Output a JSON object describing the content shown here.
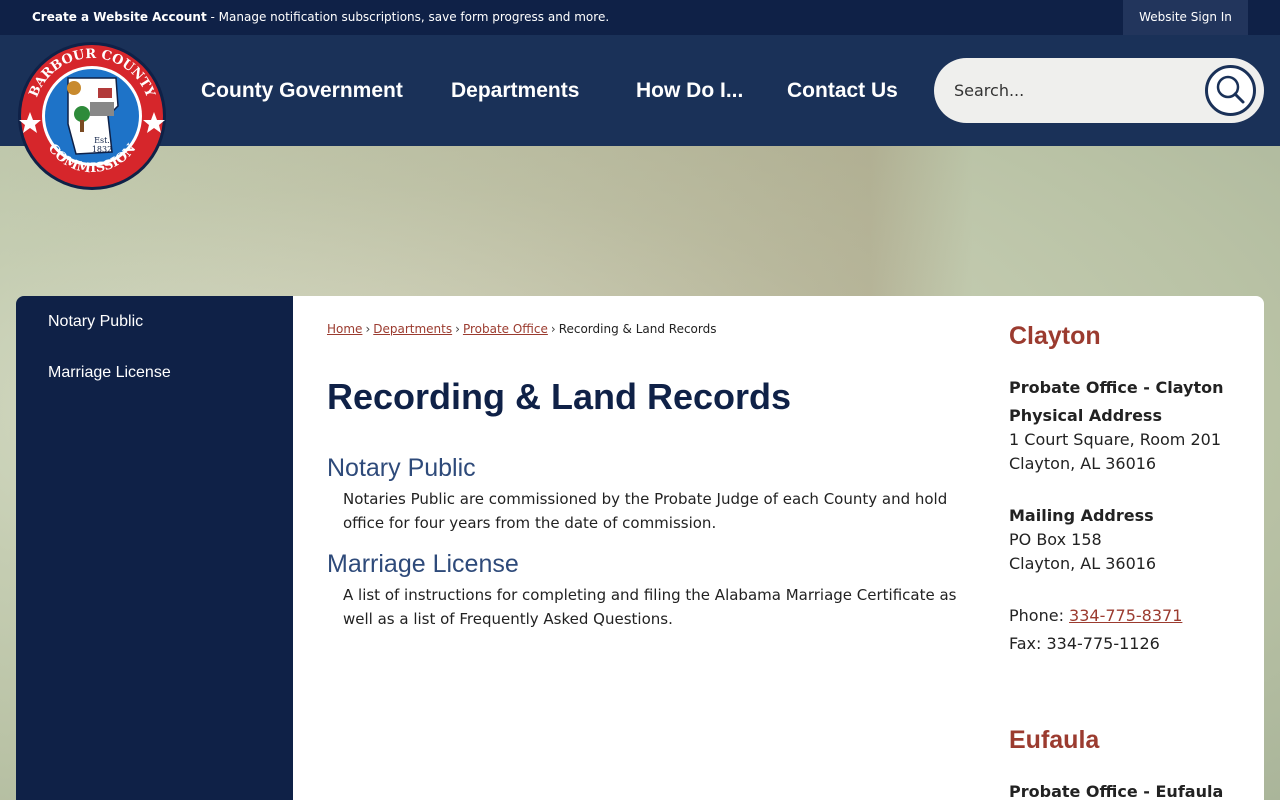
{
  "topbar": {
    "create_account": "Create a Website Account",
    "create_account_desc": " - Manage notification subscriptions, save form progress and more.",
    "sign_in": "Website Sign In"
  },
  "logo": {
    "ring_top": "BARBOUR COUNTY",
    "ring_bottom": "COMMISSION",
    "est": "Est.",
    "year": "1832"
  },
  "nav": {
    "items": [
      "County Government",
      "Departments",
      "How Do I...",
      "Contact Us"
    ]
  },
  "search": {
    "placeholder": "Search..."
  },
  "sidebar": {
    "items": [
      "Notary Public",
      "Marriage License"
    ]
  },
  "breadcrumb": {
    "home": "Home",
    "departments": "Departments",
    "probate": "Probate Office",
    "current": "Recording & Land Records",
    "sep": "›"
  },
  "main": {
    "title": "Recording & Land Records",
    "sections": [
      {
        "heading": "Notary Public",
        "text": "Notaries Public are commissioned by the Probate Judge of each County and hold office for four years from the date of commission."
      },
      {
        "heading": "Marriage License",
        "text": "A list of instructions for completing and filing the Alabama Marriage Certificate as well as a list of Frequently Asked Questions."
      }
    ]
  },
  "contact": {
    "clayton": {
      "heading": "Clayton",
      "office": "Probate Office - Clayton",
      "physical_label": "Physical Address",
      "physical_1": "1 Court Square, Room 201",
      "physical_2": "Clayton, AL 36016",
      "mailing_label": "Mailing Address",
      "mailing_1": "PO Box 158",
      "mailing_2": "Clayton, AL 36016",
      "phone_label": "Phone: ",
      "phone": "334-775-8371",
      "fax": "Fax: 334-775-1126"
    },
    "eufaula": {
      "heading": "Eufaula",
      "office": "Probate Office - Eufaula"
    }
  },
  "colors": {
    "navy": "#0f2147",
    "header": "#1a3158",
    "accent_red": "#9b3b2f",
    "heading_blue": "#2e4a7a"
  }
}
